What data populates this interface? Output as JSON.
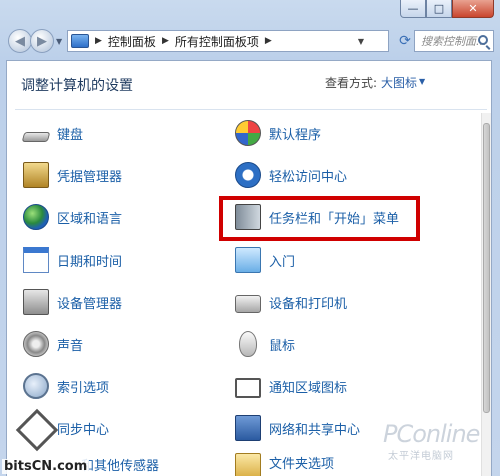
{
  "window": {
    "min_label": "—",
    "max_label": "□",
    "close_label": "✕"
  },
  "navigation": {
    "back_glyph": "◀",
    "forward_glyph": "▶",
    "breadcrumb": [
      "控制面板",
      "所有控制面板项"
    ],
    "search_placeholder": "搜索控制面..."
  },
  "content": {
    "heading": "调整计算机的设置",
    "view_by_label": "查看方式:",
    "view_by_value": "大图标"
  },
  "items_left": [
    {
      "label": "键盘",
      "icon": "keyboard-icon"
    },
    {
      "label": "凭据管理器",
      "icon": "credential-manager-icon"
    },
    {
      "label": "区域和语言",
      "icon": "globe-icon"
    },
    {
      "label": "日期和时间",
      "icon": "calendar-icon"
    },
    {
      "label": "设备管理器",
      "icon": "device-manager-icon"
    },
    {
      "label": "声音",
      "icon": "speaker-icon"
    },
    {
      "label": "索引选项",
      "icon": "magnifier-icon"
    },
    {
      "label": "同步中心",
      "icon": "sync-icon"
    },
    {
      "label": "和其他传感器",
      "icon": "sensor-icon"
    }
  ],
  "items_right": [
    {
      "label": "默认程序",
      "icon": "default-programs-icon"
    },
    {
      "label": "轻松访问中心",
      "icon": "ease-of-access-icon"
    },
    {
      "label": "任务栏和「开始」菜单",
      "icon": "taskbar-icon"
    },
    {
      "label": "入门",
      "icon": "getting-started-icon"
    },
    {
      "label": "设备和打印机",
      "icon": "printer-icon"
    },
    {
      "label": "鼠标",
      "icon": "mouse-icon"
    },
    {
      "label": "通知区域图标",
      "icon": "notification-area-icon"
    },
    {
      "label": "网络和共享中心",
      "icon": "network-icon"
    },
    {
      "label": "文件夹选项",
      "icon": "folder-options-icon"
    }
  ],
  "watermarks": {
    "pconline": "PConline",
    "pconline_sub": "太平洋电脑网",
    "bits": "bitsCN.com"
  },
  "colors": {
    "link": "#1b5fa7",
    "highlight": "#d00000",
    "heading": "#1e3a5f"
  }
}
